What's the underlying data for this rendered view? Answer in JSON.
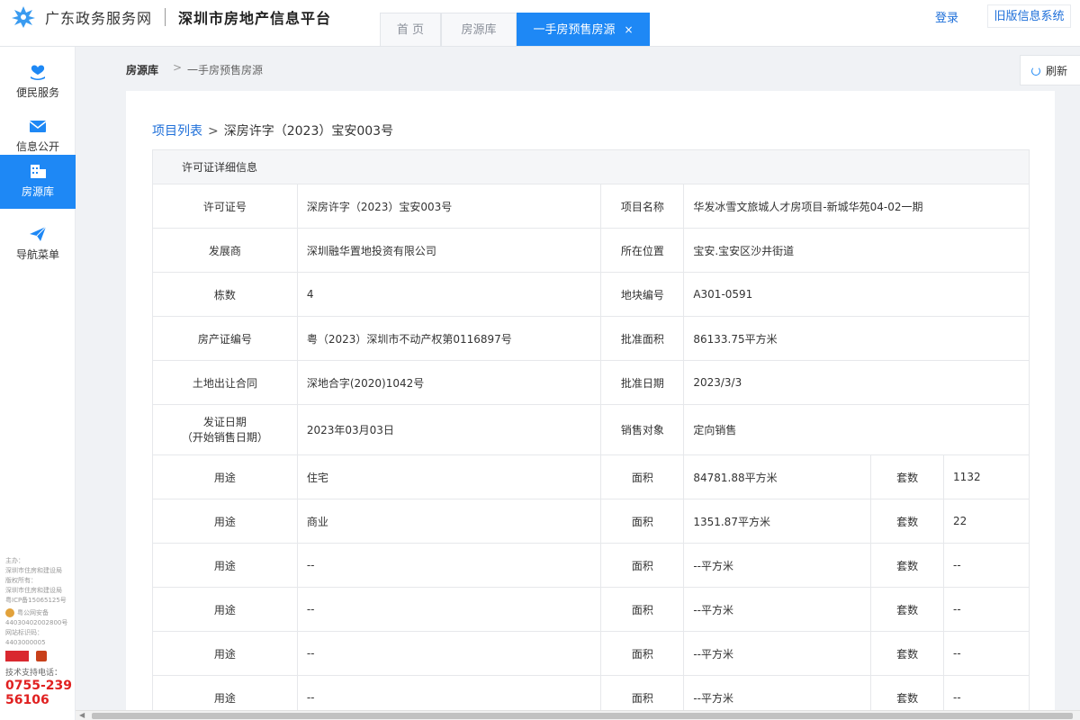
{
  "header": {
    "gd_title": "广东政务服务网",
    "sz_title": "深圳市房地产信息平台",
    "tabs": [
      {
        "label": "首 页"
      },
      {
        "label": "房源库"
      },
      {
        "label": "一手房预售房源",
        "close": "×"
      }
    ],
    "login": "登录",
    "old_system": "旧版信息系统"
  },
  "sidebar": {
    "items": [
      {
        "label": "便民服务",
        "icon": "heart-hand-icon"
      },
      {
        "label": "信息公开",
        "icon": "mail-icon"
      },
      {
        "label": "房源库",
        "icon": "building-icon"
      },
      {
        "label": "导航菜单",
        "icon": "paper-plane-icon"
      }
    ],
    "footer": {
      "lines": [
        "主办：",
        "深圳市住房和建设局",
        "版权所有：",
        "深圳市住房和建设局",
        "粤ICP备15065125号"
      ],
      "police": "粤公网安备",
      "police_no": "44030402002800号",
      "site_id_label": "网站标识码：",
      "site_id": "4403000005",
      "tel_label": "技术支持电话：",
      "tel_1": "0755-239",
      "tel_2": "56106"
    }
  },
  "breadcrumb": {
    "root": "房源库",
    "arrow": ">",
    "current": "一手房预售房源",
    "refresh": "刷新"
  },
  "content": {
    "sub_link": "项目列表",
    "sub_gt": ">",
    "sub_current": "深房许字（2023）宝安003号",
    "section_title": "许可证详细信息",
    "rows": [
      {
        "l1": "许可证号",
        "v1": "深房许字（2023）宝安003号",
        "l2": "项目名称",
        "v2": "华发冰雪文旅城人才房项目-新城华苑04-02一期"
      },
      {
        "l1": "发展商",
        "v1": "深圳融华置地投资有限公司",
        "l2": "所在位置",
        "v2": "宝安.宝安区沙井街道"
      },
      {
        "l1": "栋数",
        "v1": "4",
        "l2": "地块编号",
        "v2": "A301-0591"
      },
      {
        "l1": "房产证编号",
        "v1": "粤（2023）深圳市不动产权第0116897号",
        "l2": "批准面积",
        "v2": "86133.75平方米"
      },
      {
        "l1": "土地出让合同",
        "v1": "深地合字(2020)1042号",
        "l2": "批准日期",
        "v2": "2023/3/3"
      }
    ],
    "issue": {
      "l1a": "发证日期",
      "l1b": "（开始销售日期）",
      "v1": "2023年03月03日",
      "l2": "销售对象",
      "v2": "定向销售"
    },
    "usage": [
      {
        "use_label": "用途",
        "use": "住宅",
        "area_label": "面积",
        "area": "84781.88平方米",
        "count_label": "套数",
        "count": "1132"
      },
      {
        "use_label": "用途",
        "use": "商业",
        "area_label": "面积",
        "area": "1351.87平方米",
        "count_label": "套数",
        "count": "22"
      },
      {
        "use_label": "用途",
        "use": "--",
        "area_label": "面积",
        "area": "--平方米",
        "count_label": "套数",
        "count": "--"
      },
      {
        "use_label": "用途",
        "use": "--",
        "area_label": "面积",
        "area": "--平方米",
        "count_label": "套数",
        "count": "--"
      },
      {
        "use_label": "用途",
        "use": "--",
        "area_label": "面积",
        "area": "--平方米",
        "count_label": "套数",
        "count": "--"
      },
      {
        "use_label": "用途",
        "use": "--",
        "area_label": "面积",
        "area": "--平方米",
        "count_label": "套数",
        "count": "--"
      }
    ]
  },
  "colors": {
    "accent": "#1e88f5",
    "link": "#1e6fd9",
    "tel": "#e02020"
  }
}
